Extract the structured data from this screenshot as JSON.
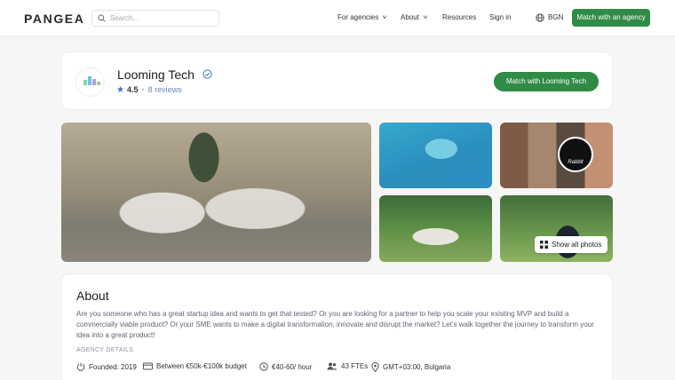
{
  "header": {
    "logo": "PANGEA",
    "search_placeholder": "Search...",
    "nav": [
      "For agencies",
      "About",
      "Resources",
      "Sign in"
    ],
    "currency": "BGN",
    "cta": "Match with an agency"
  },
  "profile": {
    "name": "Looming Tech",
    "rating": "4.5",
    "reviews": "8 reviews",
    "cta": "Match with Looming Tech"
  },
  "gallery": {
    "show_all": "Show all photos",
    "badge_text": "Rabbit"
  },
  "about": {
    "title": "About",
    "body": "Are you someone who has a great startup idea and wants to get that tested? Or you are looking for a partner to help you scale your existing MVP and build a commercially viable product? Or your SME wants to make a digital transformation, innovate and disrupt the market? Let’s walk together the journey to transform your idea into a great product!",
    "details_label": "AGENCY DETAILS",
    "details": [
      "Founded: 2019",
      "Between €50k-€100k budget",
      "€40-60/ hour",
      "43 FTEs",
      "GMT+03:00, Bulgaria"
    ]
  },
  "colors": {
    "accent": "#2f8b45",
    "star": "#3a74c4",
    "verified": "#3a74c4"
  },
  "icons": [
    "search-icon",
    "chevron-down-icon",
    "globe-icon",
    "verified-icon",
    "star-icon",
    "heart-icon",
    "grid-icon",
    "power-icon",
    "wallet-icon",
    "clock-icon",
    "people-icon",
    "location-pin-icon"
  ]
}
